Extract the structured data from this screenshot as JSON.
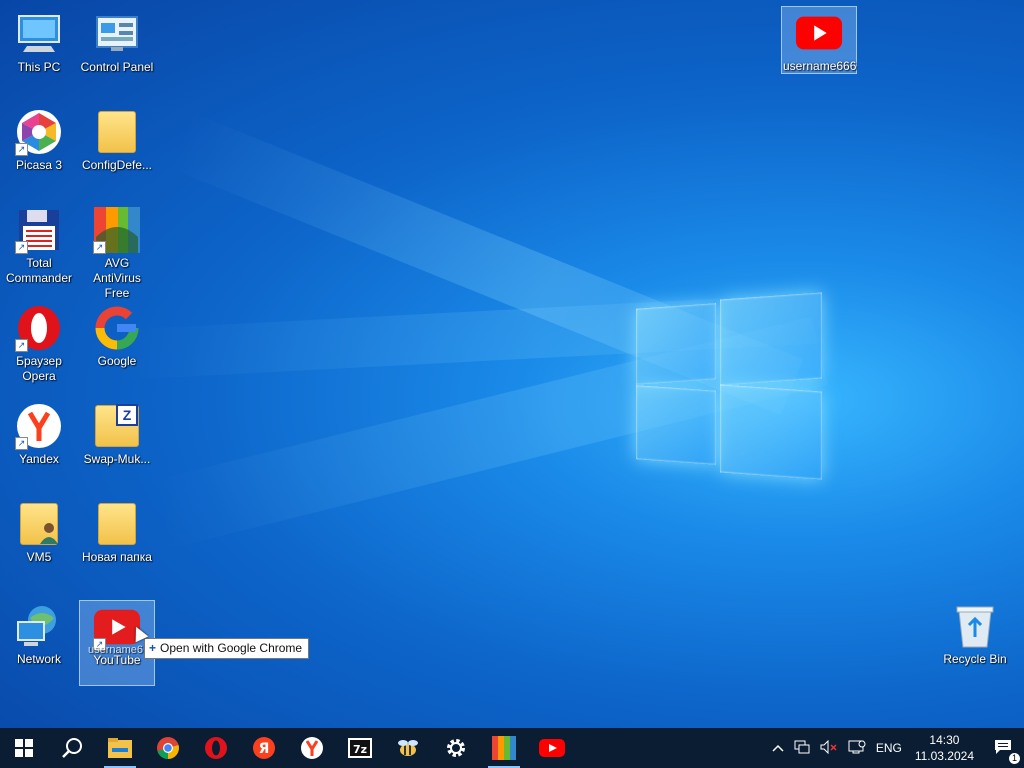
{
  "desktop": {
    "icons": [
      {
        "label": "This PC",
        "icon": "computer-icon"
      },
      {
        "label": "Control Panel",
        "icon": "control-panel-icon"
      },
      {
        "label": "Picasa 3",
        "icon": "picasa-icon"
      },
      {
        "label": "ConfigDefe...",
        "icon": "folder-icon"
      },
      {
        "label": "Total Commander",
        "icon": "floppy-icon"
      },
      {
        "label": "AVG AntiVirus Free",
        "icon": "avg-icon"
      },
      {
        "label": "Браузер Opera",
        "icon": "opera-icon"
      },
      {
        "label": "Google",
        "icon": "google-icon"
      },
      {
        "label": "Yandex",
        "icon": "yandex-icon"
      },
      {
        "label": "Swap-Muk...",
        "icon": "zip-folder-icon"
      },
      {
        "label": "VM5",
        "icon": "user-folder-icon"
      },
      {
        "label": "Новая папка",
        "icon": "folder-icon"
      },
      {
        "label": "Network",
        "icon": "network-icon"
      },
      {
        "label": "YouTube",
        "icon": "youtube-icon"
      },
      {
        "label": "username666",
        "icon": "youtube-icon"
      },
      {
        "label": "Recycle Bin",
        "icon": "recycle-bin-icon"
      }
    ],
    "drag_ghost_label": "username6",
    "tooltip": "Open with Google Chrome"
  },
  "taskbar": {
    "apps": [
      "start-icon",
      "search-icon",
      "file-explorer-icon",
      "chrome-icon",
      "opera-icon",
      "yandex-icon",
      "yandex-browser-icon",
      "7zip-icon",
      "bee-icon",
      "settings-icon",
      "avg-icon",
      "youtube-icon"
    ],
    "tray": {
      "language": "ENG",
      "time": "14:30",
      "date": "11.03.2024",
      "notification_count": "1"
    }
  },
  "colors": {
    "youtube_red": "#ff0000",
    "taskbar_bg": "#0b1d33",
    "desktop_blue": "#0d64c9"
  }
}
